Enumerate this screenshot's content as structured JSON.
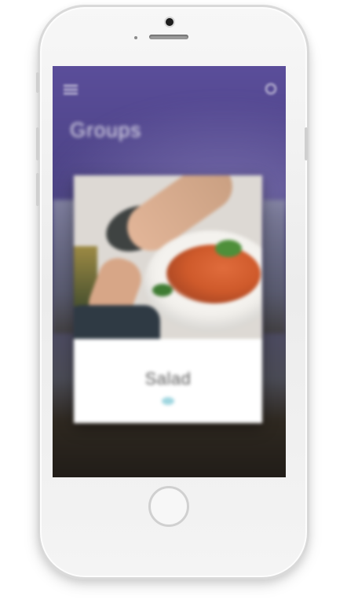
{
  "screen": {
    "header": {
      "menu_icon": "hamburger-menu-icon",
      "search_icon": "search-icon",
      "title": "Groups"
    },
    "card": {
      "eyebrow": "",
      "title": "Salad",
      "indicator_color": "#9fd6e0"
    },
    "footer": {
      "caption": ""
    }
  },
  "colors": {
    "screen_top": "#5b4e9b",
    "screen_bottom": "#1f1b17",
    "card_bg": "#ffffff"
  }
}
